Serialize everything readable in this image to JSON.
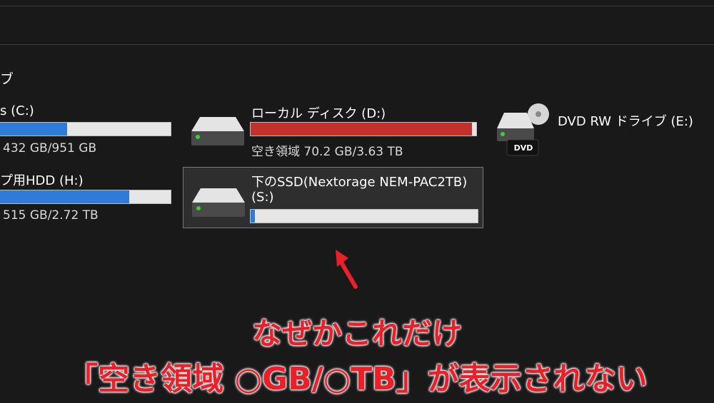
{
  "section": {
    "title": "ブ"
  },
  "drives": [
    {
      "id": "c",
      "name": "s (C:)",
      "free_text": "432 GB/951 GB",
      "used_fraction": 0.395,
      "bar_color": "#2f7bd8"
    },
    {
      "id": "h",
      "name": "プ用HDD (H:)",
      "free_text": "515 GB/2.72 TB",
      "used_fraction": 0.76,
      "bar_color": "#2f7bd8"
    },
    {
      "id": "d",
      "name": "ローカル ディスク (D:)",
      "free_text": "空き領域 70.2 GB/3.63 TB",
      "used_fraction": 0.98,
      "bar_color": "#c4302b"
    },
    {
      "id": "s",
      "name": "下のSSD(Nextorage NEM-PAC2TB)",
      "name_line2": "(S:)",
      "used_fraction": 0.02,
      "bar_color": "#2f7bd8"
    },
    {
      "id": "e",
      "name": "DVD RW ドライブ (E:)",
      "badge": "DVD"
    }
  ],
  "caption": {
    "line1": "なぜかこれだけ",
    "line2": "「空き領域 ○GB/○TB」が表示されない",
    "color": "#e8202a"
  }
}
